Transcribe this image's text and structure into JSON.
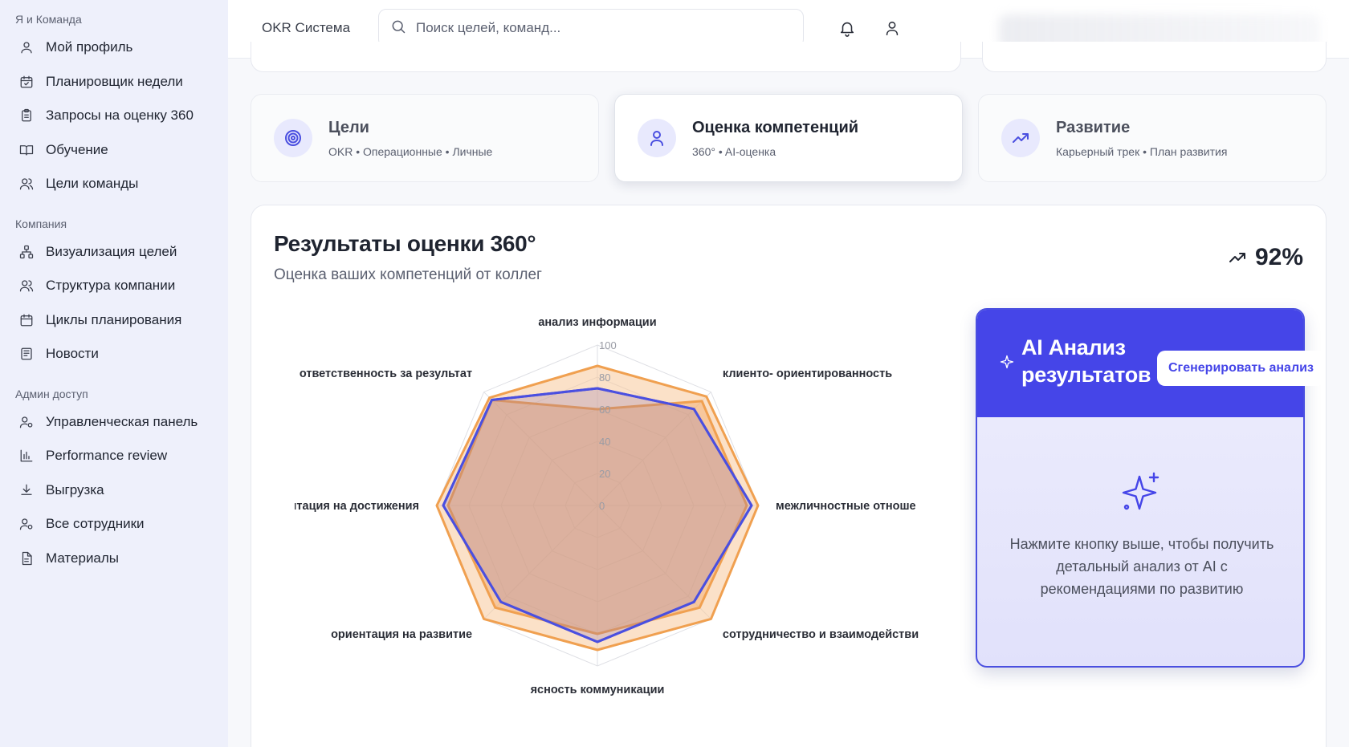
{
  "sidebar": {
    "sections": [
      {
        "title": "Я и Команда",
        "items": [
          {
            "label": "Мой профиль",
            "icon": "user-icon"
          },
          {
            "label": "Планировщик недели",
            "icon": "calendar-check-icon"
          },
          {
            "label": "Запросы на оценку 360",
            "icon": "clipboard-icon"
          },
          {
            "label": "Обучение",
            "icon": "book-icon"
          },
          {
            "label": "Цели команды",
            "icon": "users-icon"
          }
        ]
      },
      {
        "title": "Компания",
        "items": [
          {
            "label": "Визуализация целей",
            "icon": "network-icon"
          },
          {
            "label": "Структура компании",
            "icon": "users-icon"
          },
          {
            "label": "Циклы планирования",
            "icon": "calendar-icon"
          },
          {
            "label": "Новости",
            "icon": "newspaper-icon"
          }
        ]
      },
      {
        "title": "Админ доступ",
        "items": [
          {
            "label": "Управленческая панель",
            "icon": "user-cog-icon"
          },
          {
            "label": "Performance review",
            "icon": "bar-chart-icon"
          },
          {
            "label": "Выгрузка",
            "icon": "download-icon"
          },
          {
            "label": "Все сотрудники",
            "icon": "user-cog-icon"
          },
          {
            "label": "Материалы",
            "icon": "file-text-icon"
          }
        ]
      }
    ]
  },
  "header": {
    "brand": "OKR Система",
    "search_placeholder": "Поиск целей, команд...",
    "icons": [
      "bell-icon",
      "user-icon"
    ]
  },
  "categories": [
    {
      "title": "Цели",
      "subtitle": "OKR • Операционные • Личные",
      "icon": "target-icon",
      "active": false
    },
    {
      "title": "Оценка компетенций",
      "subtitle": "360° • AI-оценка",
      "icon": "user-icon",
      "active": true
    },
    {
      "title": "Развитие",
      "subtitle": "Карьерный трек • План развития",
      "icon": "trending-up-icon",
      "active": false
    }
  ],
  "results": {
    "title": "Результаты оценки 360°",
    "subtitle": "Оценка ваших компетенций от коллег",
    "score": "92%"
  },
  "chart_data": {
    "type": "radar",
    "axes": [
      "анализ информации",
      "клиенто- ориентированность",
      "межличностные отноше",
      "сотрудничество и взаимодействи",
      "ясность коммуникации",
      "ориентация на развитие",
      "иентация на достижения",
      "ответственность за результат"
    ],
    "ticks": [
      "0",
      "20",
      "40",
      "60",
      "80",
      "100"
    ],
    "range": [
      0,
      100
    ],
    "series": [
      {
        "values": [
          60,
          92,
          93,
          90,
          80,
          90,
          93,
          93
        ],
        "color": "#f0a050",
        "fill": "#f2a866"
      },
      {
        "values": [
          73,
          85,
          96,
          85,
          85,
          85,
          96,
          93
        ],
        "color": "#4a4fe0",
        "fill": "none"
      },
      {
        "values": [
          87,
          96,
          100,
          100,
          90,
          100,
          100,
          95
        ],
        "color": "#f0a050",
        "fill": "#f7c99a"
      }
    ],
    "colors": {
      "orange": "#f0a050",
      "blue": "#4a4fe0"
    }
  },
  "ai": {
    "title": "AI Анализ результатов",
    "button": "Сгенерировать анализ",
    "hint": "Нажмите кнопку выше, чтобы получить детальный анализ от AI с рекомендациями по развитию"
  },
  "colors": {
    "accent": "#4545e8",
    "sidebar_bg": "#eef0fb"
  }
}
